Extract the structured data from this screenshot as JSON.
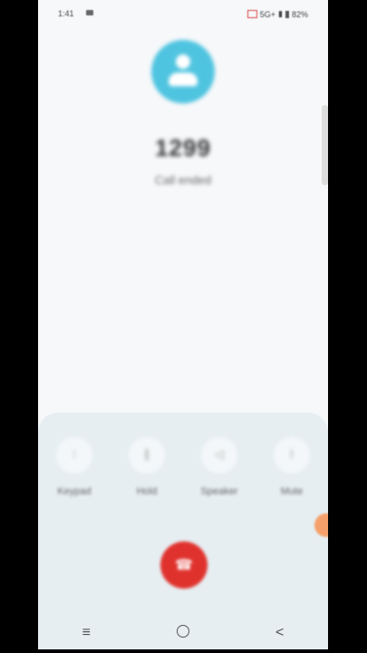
{
  "status_bar": {
    "time": "1:41",
    "network": "5G+",
    "battery": "82%"
  },
  "call": {
    "number": "1299",
    "status": "Call ended"
  },
  "controls": [
    {
      "label": "Keypad",
      "icon": "keypad-icon",
      "glyph": "⁝"
    },
    {
      "label": "Hold",
      "icon": "hold-icon",
      "glyph": "∥"
    },
    {
      "label": "Speaker",
      "icon": "speaker-icon",
      "glyph": "◁"
    },
    {
      "label": "Mute",
      "icon": "mute-icon",
      "glyph": "ǀ"
    }
  ],
  "end_call": {
    "icon": "end-call-icon",
    "glyph": "☎",
    "color": "#e0322d"
  },
  "accent_color": "#4fc4e0",
  "navbar": {
    "recents_glyph": "≡",
    "back_glyph": "<"
  }
}
